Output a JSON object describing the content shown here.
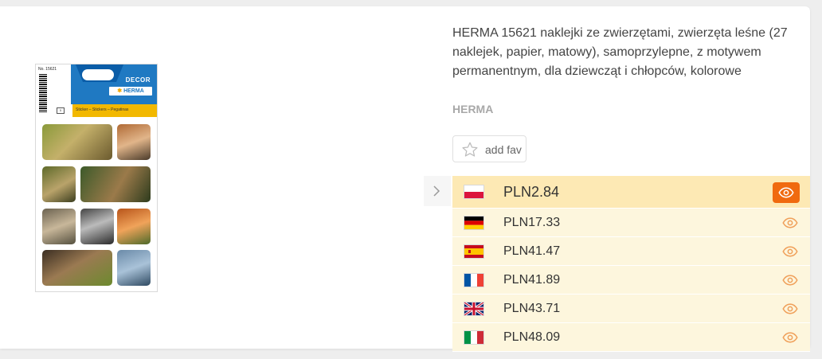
{
  "product": {
    "title": "HERMA 15621 naklejki ze zwierzętami, zwierzęta leśne (27 naklejek, papier, matowy), samoprzylepne, z motywem permanentnym, dla dziewcząt i chłopców, kolorowe",
    "brand": "HERMA",
    "fav_label": "add fav"
  },
  "package": {
    "sku": "No. 15621",
    "decor": "DECOR",
    "logo": "HERMA",
    "subtitle": "Sticker – Stickers – Pegatinas"
  },
  "offers": [
    {
      "country": "pl",
      "price": "PLN2.84",
      "highlighted": true
    },
    {
      "country": "de",
      "price": "PLN17.33",
      "highlighted": false
    },
    {
      "country": "es",
      "price": "PLN41.47",
      "highlighted": false
    },
    {
      "country": "fr",
      "price": "PLN41.89",
      "highlighted": false
    },
    {
      "country": "uk",
      "price": "PLN43.71",
      "highlighted": false
    },
    {
      "country": "it",
      "price": "PLN48.09",
      "highlighted": false
    }
  ],
  "colors": {
    "accent": "#f06a0f",
    "row_top": "#fde9b4",
    "row": "#fdf6dd"
  }
}
